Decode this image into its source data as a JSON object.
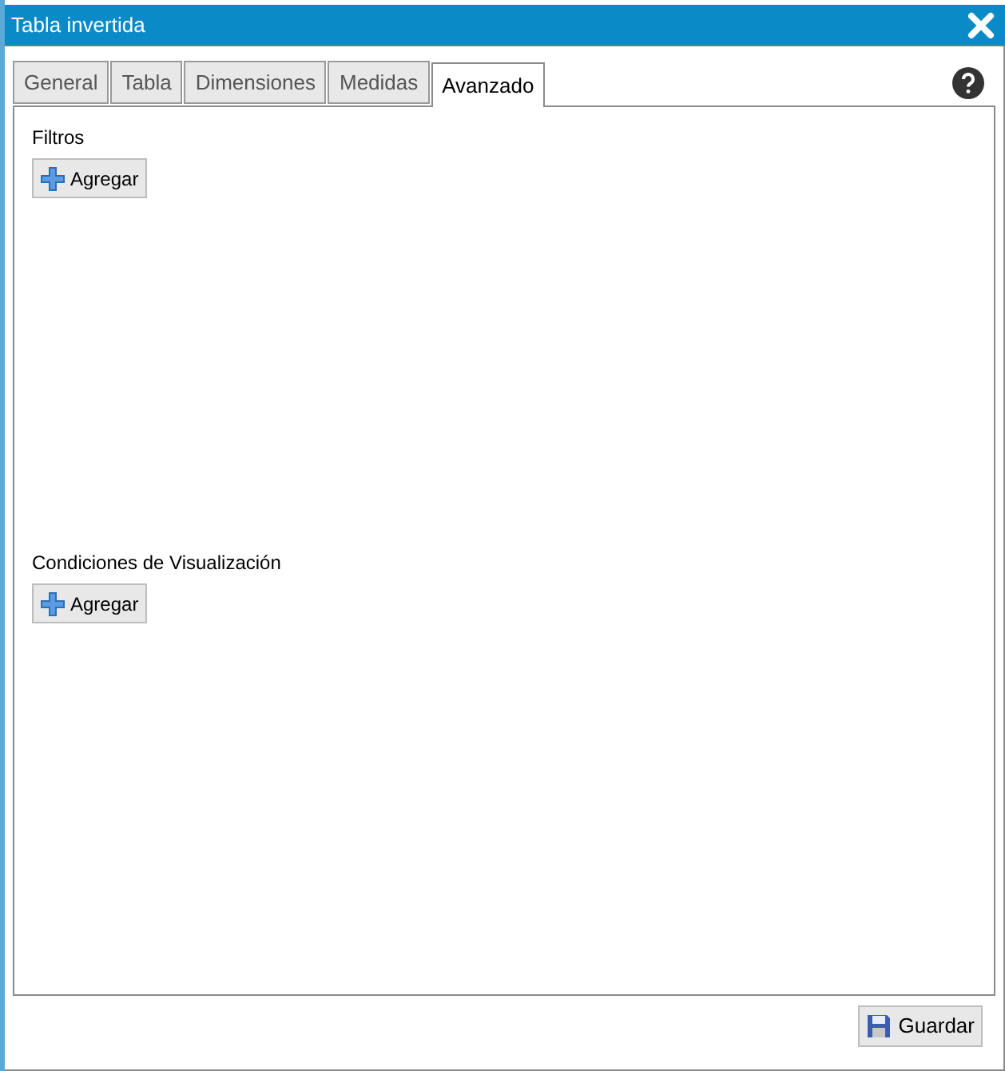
{
  "window": {
    "title": "Tabla invertida"
  },
  "tabs": [
    {
      "label": "General",
      "selected": false
    },
    {
      "label": "Tabla",
      "selected": false
    },
    {
      "label": "Dimensiones",
      "selected": false
    },
    {
      "label": "Medidas",
      "selected": false
    },
    {
      "label": "Avanzado",
      "selected": true
    }
  ],
  "sections": [
    {
      "title": "Filtros",
      "button": "Agregar"
    },
    {
      "title": "Condiciones de Visualización",
      "button": "Agregar"
    }
  ],
  "footer": {
    "button": "Guardar"
  }
}
